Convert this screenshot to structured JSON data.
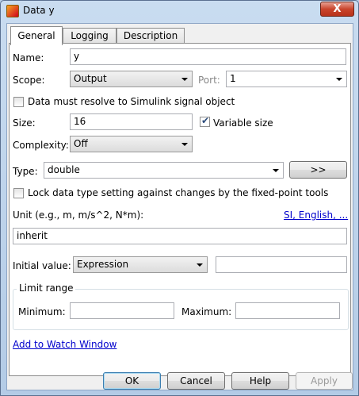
{
  "window": {
    "title": "Data y",
    "close_label": "X"
  },
  "tabs": [
    {
      "label": "General"
    },
    {
      "label": "Logging"
    },
    {
      "label": "Description"
    }
  ],
  "general": {
    "name_label": "Name:",
    "name_value": "y",
    "scope_label": "Scope:",
    "scope_value": "Output",
    "port_label": "Port:",
    "port_value": "1",
    "resolve_label": "Data must resolve to Simulink signal object",
    "size_label": "Size:",
    "size_value": "16",
    "variable_size_label": "Variable size",
    "complexity_label": "Complexity:",
    "complexity_value": "Off",
    "type_label": "Type:",
    "type_value": "double",
    "type_assistant_label": ">>",
    "lock_label": "Lock data type setting against changes by the fixed-point tools",
    "unit_label": "Unit (e.g., m, m/s^2, N*m):",
    "unit_link": "SI, English, ...",
    "unit_value": "inherit",
    "initial_value_label": "Initial value:",
    "initial_value_mode": "Expression",
    "initial_value_value": "",
    "limit_range_label": "Limit range",
    "minimum_label": "Minimum:",
    "minimum_value": "",
    "maximum_label": "Maximum:",
    "maximum_value": "",
    "watch_link": "Add to Watch Window"
  },
  "state": {
    "resolve_checked": false,
    "variable_size_checked": true,
    "lock_checked": false
  },
  "buttons": {
    "ok": "OK",
    "cancel": "Cancel",
    "help": "Help",
    "apply": "Apply"
  }
}
